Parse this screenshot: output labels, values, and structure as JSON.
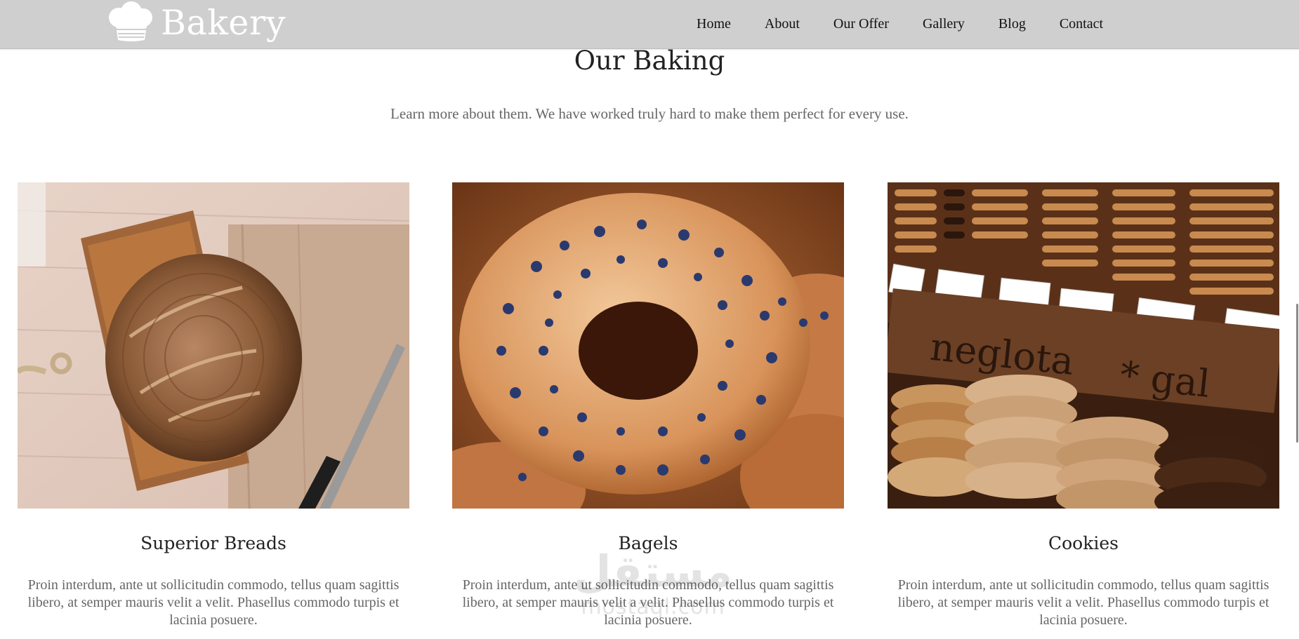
{
  "brand": {
    "logo_text": "Bakery",
    "logo_icon": "chef-hat-icon"
  },
  "nav": {
    "items": [
      {
        "label": "Home"
      },
      {
        "label": "About"
      },
      {
        "label": "Our Offer"
      },
      {
        "label": "Gallery"
      },
      {
        "label": "Blog"
      },
      {
        "label": "Contact"
      }
    ]
  },
  "section": {
    "title": "Our Baking",
    "subtitle": "Learn more about them. We have worked truly hard to make them perfect for every use."
  },
  "cards": [
    {
      "image": "bread-photo",
      "title": "Superior Breads",
      "text": "Proin interdum, ante ut sollicitudin commodo, tellus quam sagittis libero, at semper mauris velit a velit. Phasellus commodo turpis et lacinia posuere."
    },
    {
      "image": "bagel-photo",
      "title": "Bagels",
      "text": "Proin interdum, ante ut sollicitudin commodo, tellus quam sagittis libero, at semper mauris velit a velit. Phasellus commodo turpis et lacinia posuere."
    },
    {
      "image": "cookies-photo",
      "title": "Cookies",
      "text": "Proin interdum, ante ut sollicitudin commodo, tellus quam sagittis libero, at semper mauris velit a velit. Phasellus commodo turpis et lacinia posuere."
    }
  ],
  "watermark": {
    "arabic": "مستقل",
    "latin": "mostaql.com"
  },
  "colors": {
    "header_bg": "#cfcfcf",
    "heading_text": "#222222",
    "body_text": "#666666"
  }
}
